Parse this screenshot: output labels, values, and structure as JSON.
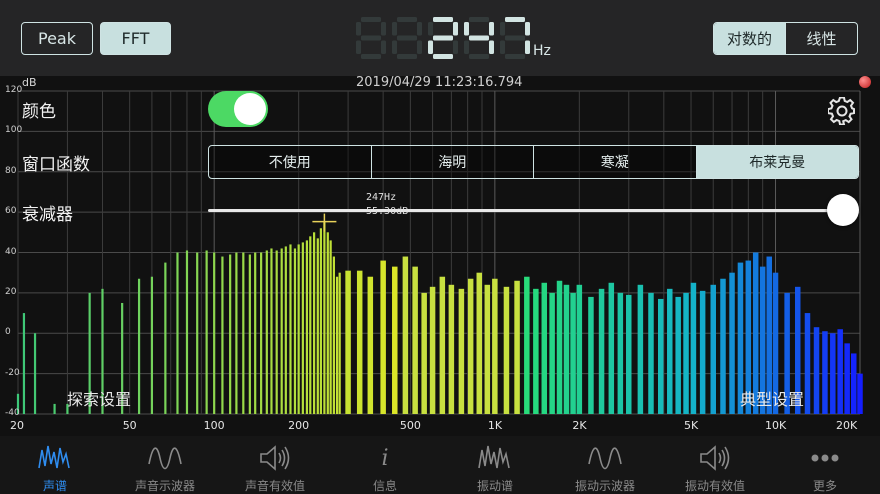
{
  "header": {
    "mode_buttons": [
      {
        "label": "Peak",
        "active": false
      },
      {
        "label": "FFT",
        "active": true
      }
    ],
    "frequency_value": "247",
    "frequency_unit": "Hz",
    "scale_toggle": [
      {
        "label": "对数的",
        "active": true
      },
      {
        "label": "线性",
        "active": false
      }
    ]
  },
  "plot": {
    "db_unit": "dB",
    "timestamp": "2019/04/29 11:23:16.794",
    "y_ticks": [
      "120",
      "100",
      "80",
      "60",
      "40",
      "20",
      "0",
      "-20",
      "-40"
    ],
    "x_ticks": [
      "20",
      "50",
      "100",
      "200",
      "500",
      "1K",
      "2K",
      "5K",
      "10K",
      "20K"
    ],
    "peak": {
      "frequency": "247Hz",
      "level": "55.30dB"
    },
    "presets": {
      "left": "探索设置",
      "right": "典型设置"
    }
  },
  "settings": {
    "color_label": "颜色",
    "color_enabled": true,
    "window_label": "窗口函数",
    "window_options": [
      {
        "label": "不使用",
        "active": false
      },
      {
        "label": "海明",
        "active": false
      },
      {
        "label": "寒凝",
        "active": false
      },
      {
        "label": "布莱克曼",
        "active": true
      }
    ],
    "attenuator_label": "衰减器",
    "attenuator_level": 1.0
  },
  "tabs": [
    {
      "label": "声谱",
      "icon": "spectrum-icon",
      "selected": true
    },
    {
      "label": "声音示波器",
      "icon": "wave-icon",
      "selected": false
    },
    {
      "label": "声音有效值",
      "icon": "speaker-icon",
      "selected": false
    },
    {
      "label": "信息",
      "icon": "info-icon",
      "selected": false
    },
    {
      "label": "振动谱",
      "icon": "spectrum-icon",
      "selected": false
    },
    {
      "label": "振动示波器",
      "icon": "wave-icon",
      "selected": false
    },
    {
      "label": "振动有效值",
      "icon": "speaker-icon",
      "selected": false
    },
    {
      "label": "更多",
      "icon": "more-icon",
      "selected": false
    }
  ],
  "chart_data": {
    "type": "bar",
    "title": "",
    "xlabel": "",
    "ylabel": "dB",
    "x_scale": "log",
    "xlim": [
      20,
      20000
    ],
    "ylim": [
      -40,
      120
    ],
    "grid": true,
    "x": [
      20,
      21,
      23,
      27,
      30,
      36,
      40,
      47,
      54,
      60,
      67,
      74,
      80,
      87,
      94,
      100,
      107,
      114,
      120,
      127,
      134,
      140,
      147,
      154,
      160,
      167,
      174,
      180,
      187,
      194,
      200,
      207,
      214,
      220,
      227,
      234,
      240,
      247,
      254,
      260,
      267,
      274,
      280,
      300,
      330,
      360,
      400,
      440,
      480,
      520,
      560,
      600,
      650,
      700,
      760,
      820,
      880,
      940,
      1000,
      1100,
      1200,
      1300,
      1400,
      1500,
      1600,
      1700,
      1800,
      1900,
      2000,
      2200,
      2400,
      2600,
      2800,
      3000,
      3300,
      3600,
      3900,
      4200,
      4500,
      4800,
      5100,
      5500,
      6000,
      6500,
      7000,
      7500,
      8000,
      8500,
      9000,
      9500,
      10000,
      11000,
      12000,
      13000,
      14000,
      15000,
      16000,
      17000,
      18000,
      19000,
      20000
    ],
    "values": [
      -30,
      10,
      0,
      -35,
      -35,
      20,
      22,
      15,
      27,
      28,
      35,
      40,
      41,
      40,
      41,
      40,
      38,
      39,
      40,
      40,
      39,
      40,
      40,
      41,
      42,
      41,
      42,
      43,
      44,
      42,
      44,
      45,
      46,
      48,
      50,
      47,
      52,
      55,
      50,
      46,
      38,
      28,
      30,
      31,
      31,
      28,
      36,
      33,
      38,
      33,
      20,
      23,
      28,
      24,
      22,
      27,
      30,
      24,
      27,
      23,
      26,
      28,
      22,
      25,
      20,
      26,
      24,
      20,
      24,
      18,
      22,
      25,
      20,
      19,
      24,
      20,
      17,
      22,
      18,
      20,
      25,
      21,
      24,
      27,
      30,
      35,
      36,
      40,
      33,
      38,
      30,
      20,
      23,
      10,
      3,
      1,
      0,
      2,
      -5,
      -10,
      -20
    ]
  }
}
